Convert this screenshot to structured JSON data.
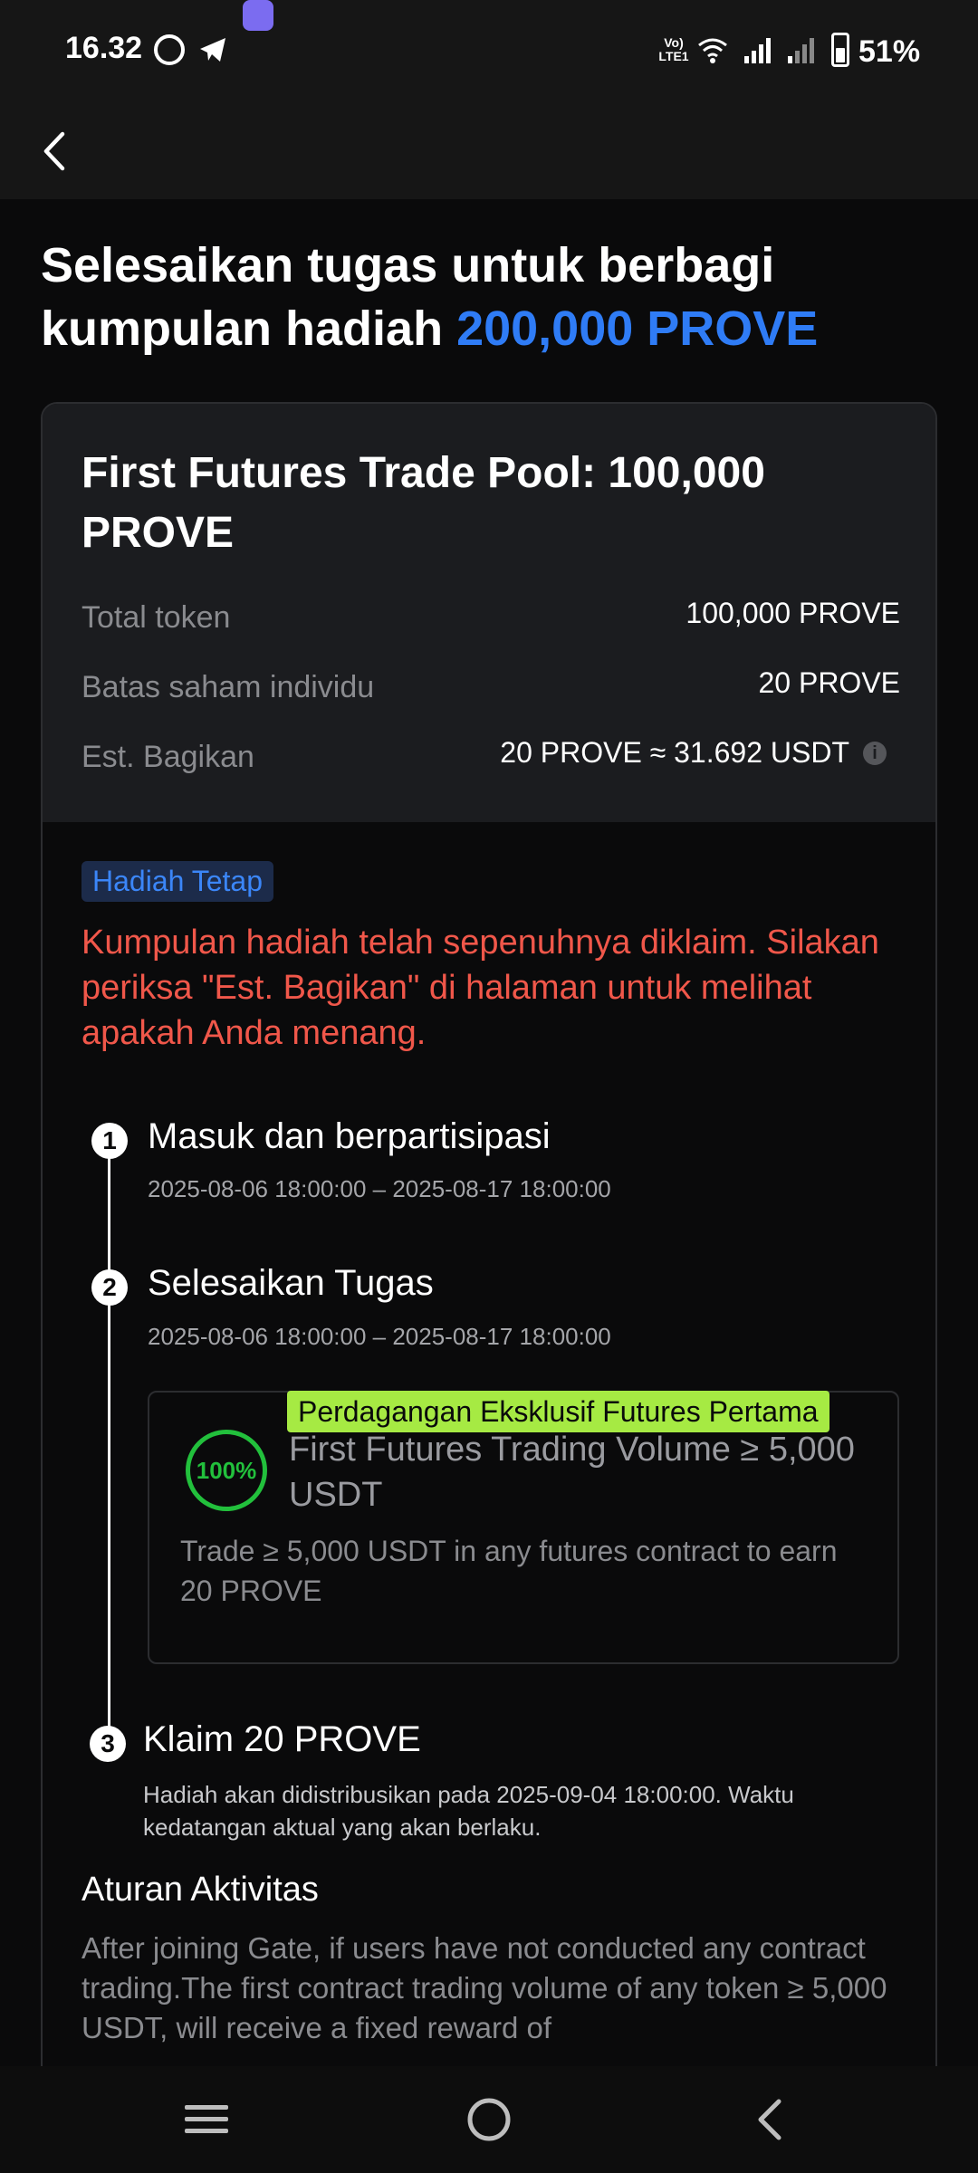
{
  "status_bar": {
    "time": "16.32",
    "network_label": "Vo) LTE1",
    "battery": "51%",
    "icons": [
      "whatsapp-icon",
      "telegram-icon",
      "app-icon",
      "wifi-icon",
      "signal-icon",
      "signal-icon",
      "battery-icon"
    ],
    "battery_level": 0.51
  },
  "header": {
    "back_icon": "chevron-left-icon"
  },
  "page": {
    "title_prefix": "Selesaikan tugas untuk berbagi kumpulan hadiah ",
    "title_highlight": "200,000 PROVE",
    "highlight_color": "#2f7cf6"
  },
  "pool": {
    "title": "First Futures Trade Pool: 100,000 PROVE",
    "rows": [
      {
        "label": "Total token",
        "value": "100,000 PROVE"
      },
      {
        "label": "Batas saham individu",
        "value": "20 PROVE"
      },
      {
        "label": "Est. Bagikan",
        "value": "20 PROVE ≈ 31.692 USDT"
      }
    ],
    "info_icon": "info-icon",
    "badge": "Hadiah Tetap",
    "notice": "Kumpulan hadiah telah sepenuhnya diklaim. Silakan periksa \"Est. Bagikan\" di halaman untuk melihat apakah Anda menang.",
    "notice_color": "#f0574a"
  },
  "steps": [
    {
      "num": "1",
      "title": "Masuk dan berpartisipasi",
      "time": "2025-08-06 18:00:00 ‒ 2025-08-17 18:00:00"
    },
    {
      "num": "2",
      "title": "Selesaikan Tugas",
      "time": "2025-08-06 18:00:00 ‒ 2025-08-17 18:00:00"
    },
    {
      "num": "3",
      "title": "Klaim 20 PROVE",
      "note": "Hadiah akan didistribusikan pada 2025-09-04 18:00:00. Waktu kedatangan aktual yang akan berlaku."
    }
  ],
  "task": {
    "tag": "Perdagangan Eksklusif Futures Pertama",
    "tag_color": "#a6ea43",
    "progress": "100%",
    "progress_color": "#22c03c",
    "title": "First Futures Trading Volume ≥ 5,000 USDT",
    "description": "Trade ≥ 5,000 USDT in any futures contract to earn 20 PROVE"
  },
  "rules": {
    "title": "Aturan Aktivitas",
    "text": "After joining Gate, if users have not conducted any contract trading.The first contract trading volume of any token ≥ 5,000 USDT,  will receive a fixed reward of"
  },
  "nav": {
    "icons": [
      "menu-icon",
      "home-icon",
      "back-icon"
    ]
  }
}
